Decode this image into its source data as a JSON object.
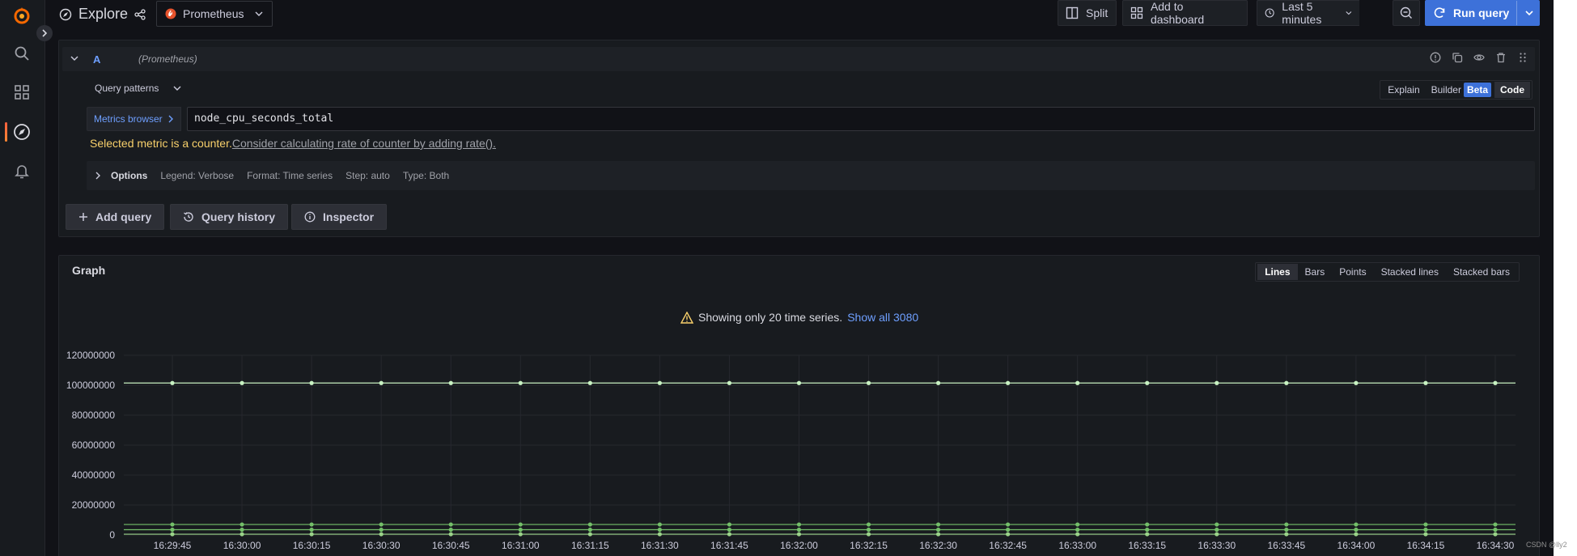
{
  "nav": {
    "items": [
      "search",
      "dashboards",
      "explore",
      "alerting"
    ]
  },
  "topbar": {
    "title": "Explore",
    "datasource": "Prometheus",
    "split_label": "Split",
    "add_dashboard_label": "Add to dashboard",
    "time_range_label": "Last 5 minutes",
    "run_query_label": "Run query"
  },
  "query": {
    "letter": "A",
    "datasource_label": "(Prometheus)",
    "patterns_label": "Query patterns",
    "mode": {
      "explain": "Explain",
      "builder": "Builder",
      "beta": "Beta",
      "code": "Code"
    },
    "metrics_browser_label": "Metrics browser",
    "expr": "node_cpu_seconds_total",
    "counter_warning": "Selected metric is a counter.",
    "counter_hint": "Consider calculating rate of counter by adding rate().",
    "options": {
      "title": "Options",
      "legend": "Legend: Verbose",
      "format": "Format: Time series",
      "step": "Step: auto",
      "type": "Type: Both"
    }
  },
  "actions": {
    "add_query": "Add query",
    "query_history": "Query history",
    "inspector": "Inspector"
  },
  "graph": {
    "title": "Graph",
    "viz_modes": [
      "Lines",
      "Bars",
      "Points",
      "Stacked lines",
      "Stacked bars"
    ],
    "active_mode": "Lines",
    "series_warning": "Showing only 20 time series.",
    "show_all_label": "Show all 3080"
  },
  "watermark": "CSDN @lly2",
  "colors": {
    "accent": "#3d71d9",
    "series_top": "#c8f2c2",
    "series_low": "#73bf69"
  },
  "chart_data": {
    "type": "line",
    "x": [
      "16:29:45",
      "16:30:00",
      "16:30:15",
      "16:30:30",
      "16:30:45",
      "16:31:00",
      "16:31:15",
      "16:31:30",
      "16:31:45",
      "16:32:00",
      "16:32:15",
      "16:32:30",
      "16:32:45",
      "16:33:00",
      "16:33:15",
      "16:33:30",
      "16:33:45",
      "16:34:00",
      "16:34:15",
      "16:34:30"
    ],
    "yticks": [
      "0",
      "20000000",
      "40000000",
      "60000000",
      "80000000",
      "100000000",
      "120000000"
    ],
    "ylim": [
      0,
      120000000
    ],
    "series": [
      {
        "values": [
          101500000,
          101500000,
          101500000,
          101500000,
          101500000,
          101500000,
          101500000,
          101500000,
          101500000,
          101500000,
          101500000,
          101500000,
          101500000,
          101500000,
          101500000,
          101500000,
          101500000,
          101500000,
          101500000,
          101500000
        ]
      },
      {
        "values": [
          7000000,
          7000000,
          7000000,
          7000000,
          7000000,
          7000000,
          7000000,
          7000000,
          7000000,
          7000000,
          7000000,
          7000000,
          7000000,
          7000000,
          7000000,
          7000000,
          7000000,
          7000000,
          7000000,
          7000000
        ]
      },
      {
        "values": [
          3500000,
          3500000,
          3500000,
          3500000,
          3500000,
          3500000,
          3500000,
          3500000,
          3500000,
          3500000,
          3500000,
          3500000,
          3500000,
          3500000,
          3500000,
          3500000,
          3500000,
          3500000,
          3500000,
          3500000
        ]
      },
      {
        "values": [
          500000,
          500000,
          500000,
          500000,
          500000,
          500000,
          500000,
          500000,
          500000,
          500000,
          500000,
          500000,
          500000,
          500000,
          500000,
          500000,
          500000,
          500000,
          500000,
          500000
        ]
      }
    ],
    "grid": true,
    "legend": "none"
  }
}
